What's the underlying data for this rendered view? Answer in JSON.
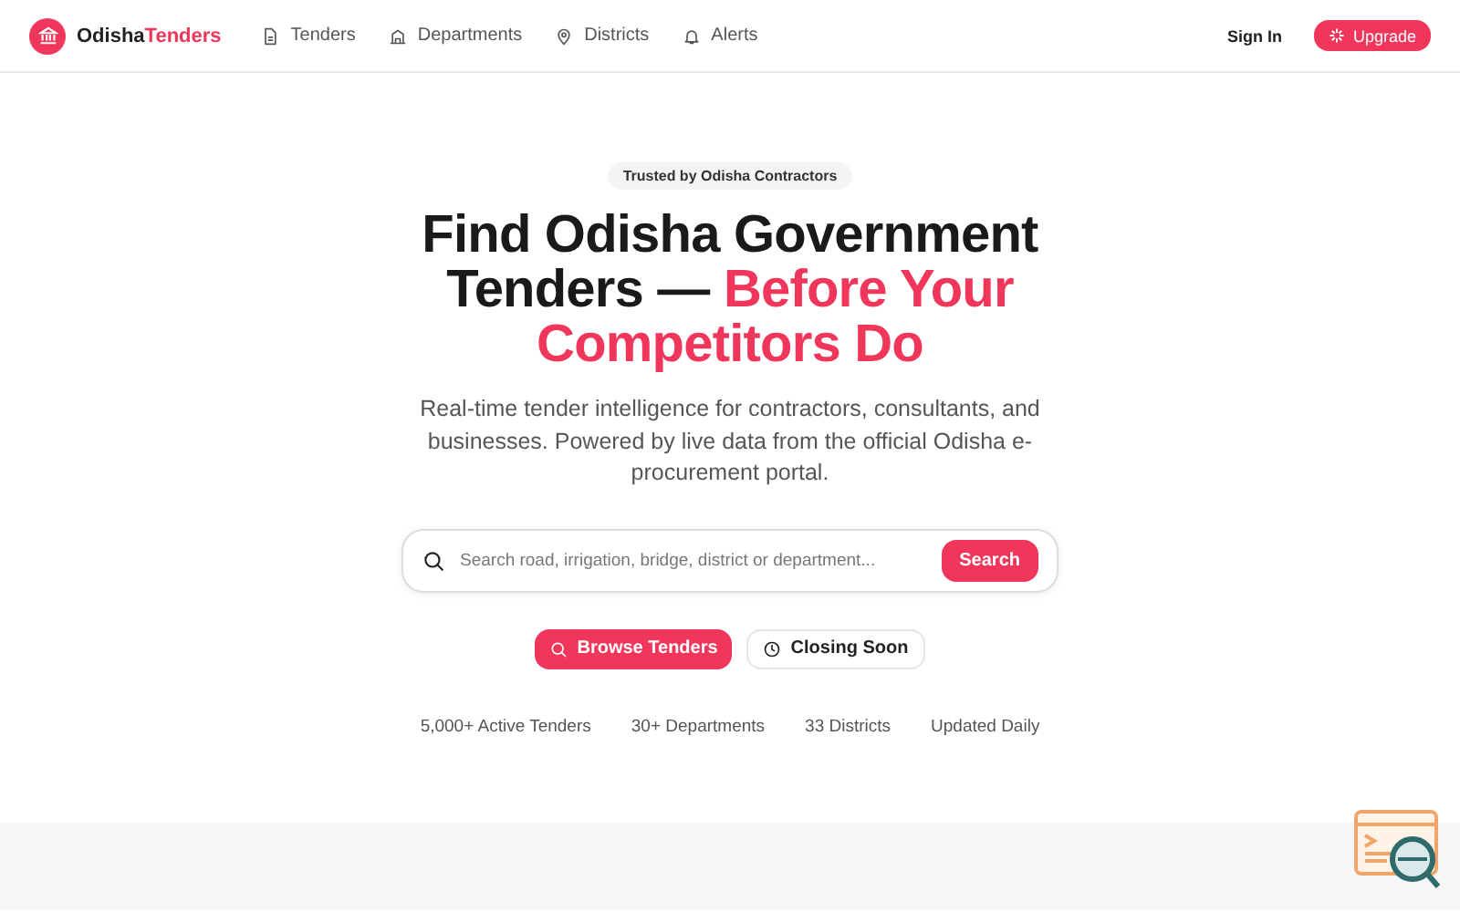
{
  "brand": {
    "lead": "Odisha",
    "accent": "Tenders"
  },
  "nav": [
    {
      "label": "Tenders"
    },
    {
      "label": "Departments"
    },
    {
      "label": "Districts"
    },
    {
      "label": "Alerts"
    }
  ],
  "auth": {
    "sign_in": "Sign In",
    "upgrade": "Upgrade"
  },
  "hero": {
    "badge": "Trusted by Odisha Contractors",
    "title_lead": "Find Odisha Government Tenders — ",
    "title_accent": "Before Your Competitors Do",
    "subtitle": "Real-time tender intelligence for contractors, consultants, and businesses. Powered by live data from the official Odisha e-procurement portal."
  },
  "search": {
    "placeholder": "Search road, irrigation, bridge, district or department...",
    "button": "Search"
  },
  "actions": [
    {
      "label": "Browse Tenders",
      "kind": "primary"
    },
    {
      "label": "Closing Soon",
      "kind": "secondary"
    }
  ],
  "stats": [
    "5,000+ Active Tenders",
    "30+ Departments",
    "33 Districts",
    "Updated Daily"
  ]
}
